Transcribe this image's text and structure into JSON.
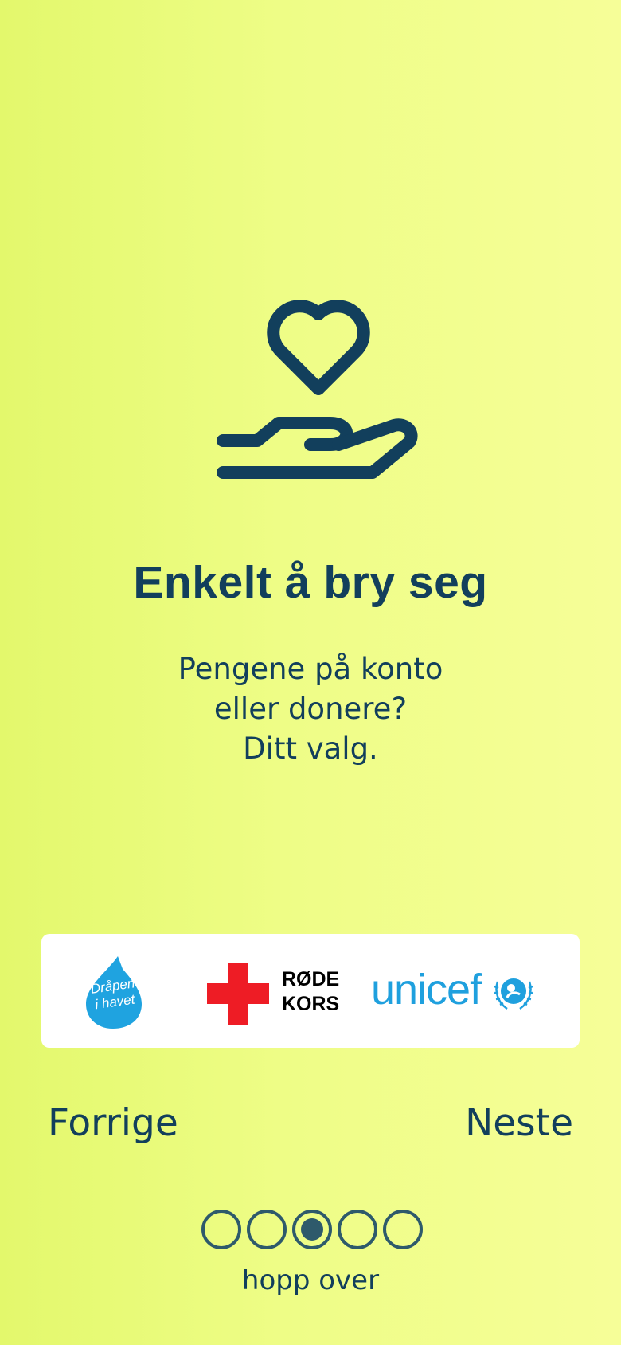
{
  "onboarding": {
    "title": "Enkelt å bry seg",
    "subtitle_lines": [
      "Pengene på konto",
      "eller donere?",
      "Ditt valg."
    ],
    "hero_icon": "heart-in-hand-icon"
  },
  "partners": {
    "drapen": {
      "line1": "Dråpen",
      "line2": "i havet"
    },
    "red_cross": {
      "line1": "RØDE",
      "line2": "KORS"
    },
    "unicef": {
      "label": "unicef"
    }
  },
  "nav": {
    "prev_label": "Forrige",
    "next_label": "Neste",
    "skip_label": "hopp over"
  },
  "pagination": {
    "total": 5,
    "current": 3
  },
  "colors": {
    "background_start": "#e3f86c",
    "background_end": "#f6fe98",
    "primary_text": "#123f5c",
    "dot": "#2e5a6b",
    "red_cross": "#ee1c25",
    "unicef_blue": "#1fa0de",
    "drop_blue": "#1fa3e0"
  }
}
